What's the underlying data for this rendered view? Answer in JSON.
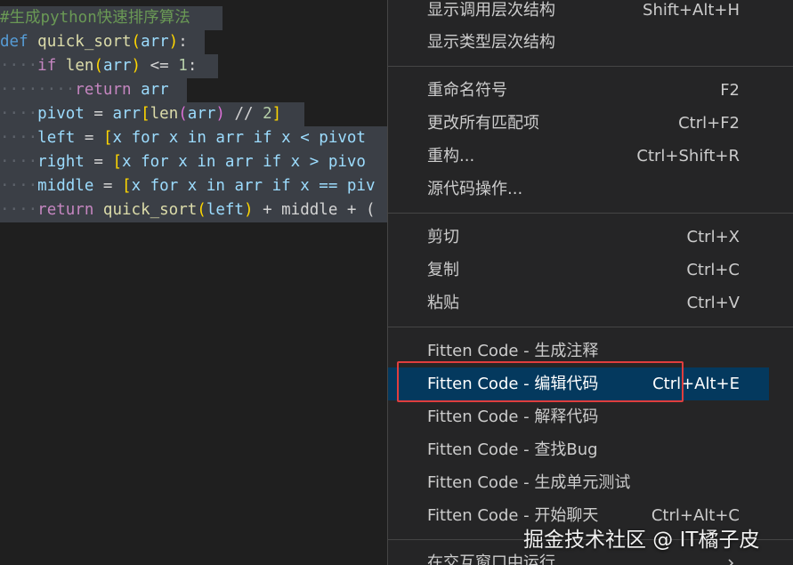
{
  "editor": {
    "lines": [
      {
        "comment": "#生成python快速排序算法"
      },
      {
        "kw": "def",
        "fn": "quick_sort",
        "param": "arr",
        "tail": ":"
      },
      {
        "kw": "if",
        "fn": "len",
        "arg": "arr",
        "op": "<=",
        "num": "1",
        "tail": ":"
      },
      {
        "kw": "return",
        "id": "arr"
      },
      {
        "id": "pivot",
        "rhs": "arr",
        "fn": "len",
        "arg": "arr",
        "op": "//",
        "num": "2"
      },
      {
        "id": "left",
        "expr": "x for x in arr if x < pivot"
      },
      {
        "id": "right",
        "expr": "x for x in arr if x > pivo"
      },
      {
        "id": "middle",
        "expr": "x for x in arr if x == piv"
      },
      {
        "kw": "return",
        "fn": "quick_sort",
        "arg": "left",
        "tail": "+ middle + ("
      }
    ]
  },
  "menu": {
    "items": [
      {
        "label": "显示调用层次结构",
        "key": "Shift+Alt+H"
      },
      {
        "label": "显示类型层次结构",
        "key": ""
      },
      {
        "label": "重命名符号",
        "key": "F2"
      },
      {
        "label": "更改所有匹配项",
        "key": "Ctrl+F2"
      },
      {
        "label": "重构...",
        "key": "Ctrl+Shift+R"
      },
      {
        "label": "源代码操作...",
        "key": ""
      },
      {
        "label": "剪切",
        "key": "Ctrl+X"
      },
      {
        "label": "复制",
        "key": "Ctrl+C"
      },
      {
        "label": "粘贴",
        "key": "Ctrl+V"
      },
      {
        "label": "Fitten Code - 生成注释",
        "key": ""
      },
      {
        "label": "Fitten Code - 编辑代码",
        "key": "Ctrl+Alt+E"
      },
      {
        "label": "Fitten Code - 解释代码",
        "key": ""
      },
      {
        "label": "Fitten Code - 查找Bug",
        "key": ""
      },
      {
        "label": "Fitten Code - 生成单元测试",
        "key": ""
      },
      {
        "label": "Fitten Code - 开始聊天",
        "key": "Ctrl+Alt+C"
      },
      {
        "label": "在交互窗口中运行",
        "key": ""
      }
    ]
  },
  "watermark": "掘金技术社区 @ IT橘子皮"
}
